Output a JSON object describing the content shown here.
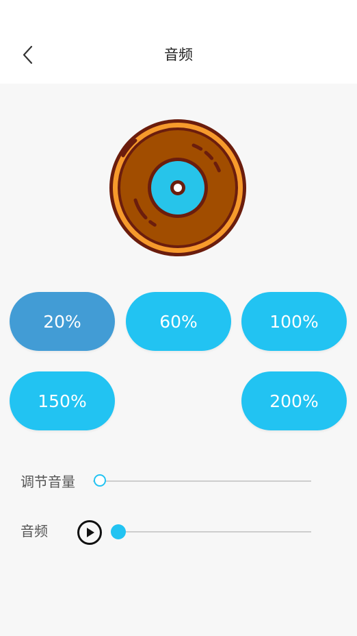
{
  "header": {
    "title": "音频",
    "back_icon": "chevron-left-icon"
  },
  "disc": {
    "icon": "vinyl-record-icon",
    "colors": {
      "outline": "#6b1d0d",
      "outer_ring": "#f69a2c",
      "disc": "#a14d00",
      "label": "#27c4ea"
    }
  },
  "speed_buttons": [
    {
      "label": "20%",
      "selected": true
    },
    {
      "label": "60%",
      "selected": false
    },
    {
      "label": "100%",
      "selected": false
    },
    {
      "label": "150%",
      "selected": false
    },
    {
      "label": "200%",
      "selected": false
    }
  ],
  "volume": {
    "label": "调节音量",
    "value_fraction": 0.0
  },
  "audio": {
    "label": "音频",
    "play_icon": "play-circle-icon",
    "progress_fraction": 0.0
  },
  "colors": {
    "accent": "#22c3f2",
    "selected": "#429cd5",
    "background": "#f7f7f7"
  }
}
